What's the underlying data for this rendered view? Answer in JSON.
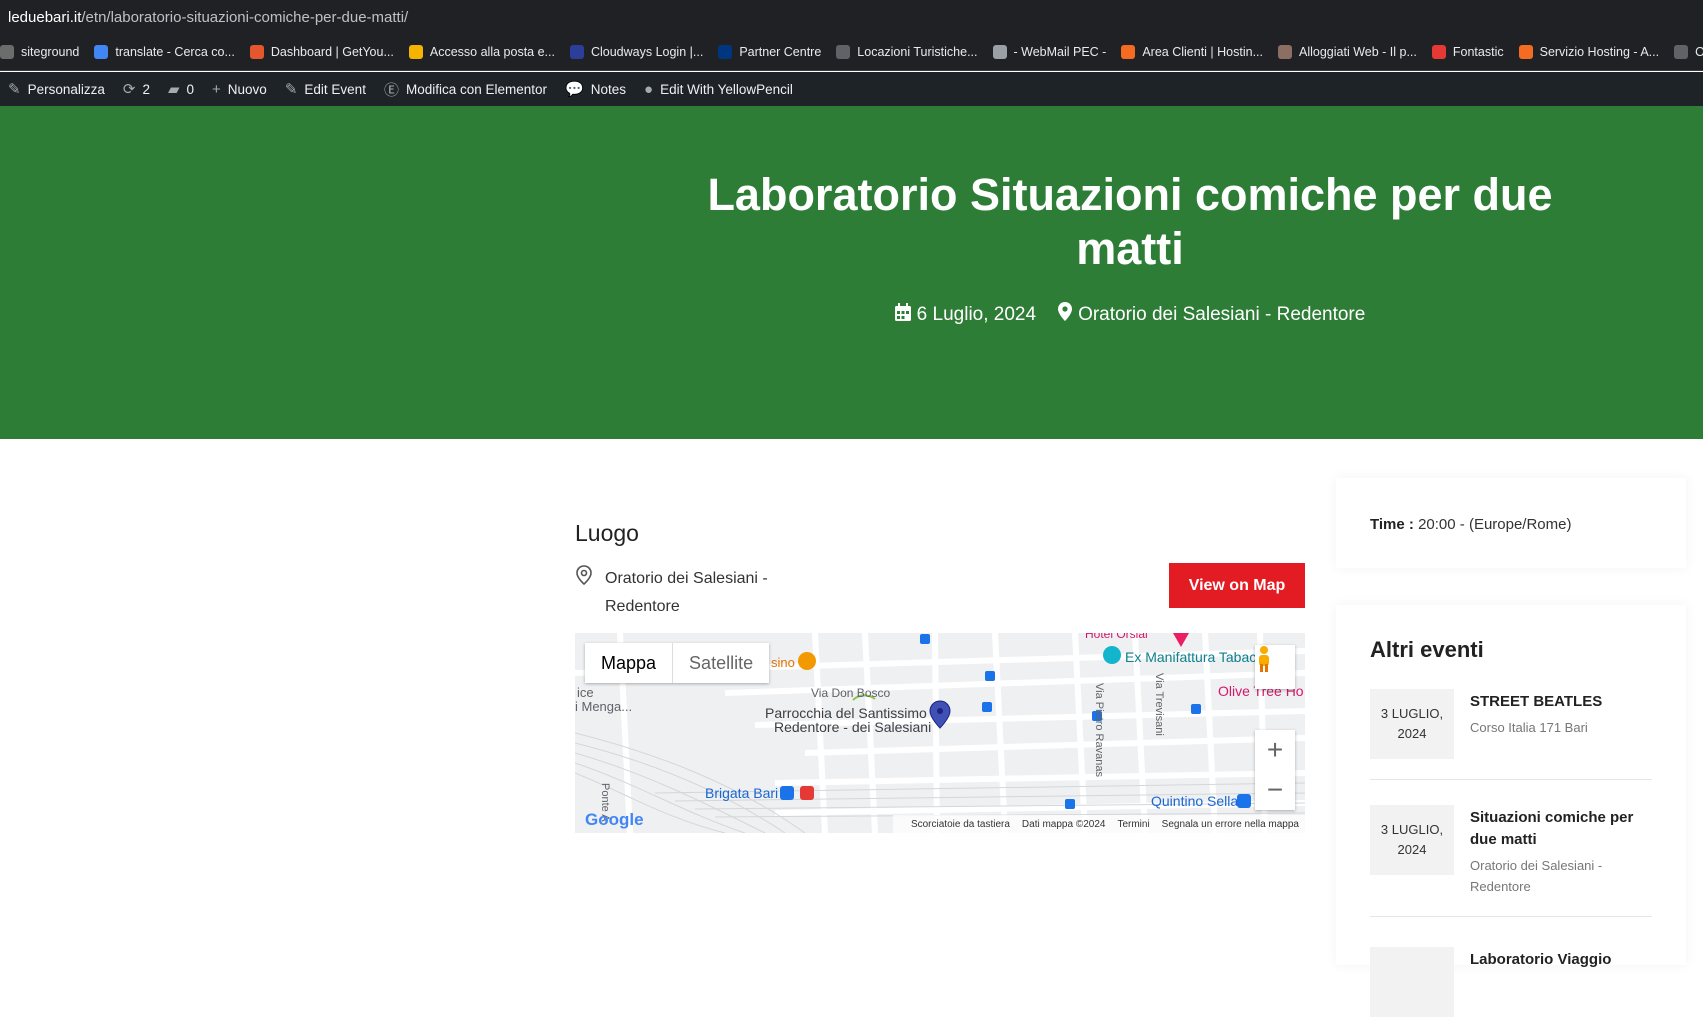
{
  "browser": {
    "url_host": "leduebari.it",
    "url_path": "/etn/laboratorio-situazioni-comiche-per-due-matti/",
    "bookmarks": [
      {
        "label": "siteground",
        "color": "#6c6c6c"
      },
      {
        "label": "translate - Cerca co...",
        "color": "#4285f4"
      },
      {
        "label": "Dashboard | GetYou...",
        "color": "#e4572e"
      },
      {
        "label": "Accesso alla posta e...",
        "color": "#f4b400"
      },
      {
        "label": "Cloudways Login |...",
        "color": "#2c3e99"
      },
      {
        "label": "Partner Centre",
        "color": "#003580"
      },
      {
        "label": "Locazioni Turistiche...",
        "color": "#5f6368"
      },
      {
        "label": "- WebMail PEC -",
        "color": "#9aa0a6"
      },
      {
        "label": "Area Clienti | Hostin...",
        "color": "#f36c21"
      },
      {
        "label": "Alloggiati Web - Il p...",
        "color": "#8d6e63"
      },
      {
        "label": "Fontastic",
        "color": "#e53935"
      },
      {
        "label": "Servizio Hosting - A...",
        "color": "#f36c21"
      },
      {
        "label": "Operatori r",
        "color": "#5f6368"
      }
    ]
  },
  "wpbar": {
    "items": [
      {
        "label": "Personalizza",
        "icon": "brush-icon"
      },
      {
        "label": "2",
        "icon": "updates-icon"
      },
      {
        "label": "0",
        "icon": "comment-icon"
      },
      {
        "label": "Nuovo",
        "icon": "plus-icon"
      },
      {
        "label": "Edit Event",
        "icon": "pencil-icon"
      },
      {
        "label": "Modifica con Elementor",
        "icon": "elementor-icon"
      },
      {
        "label": "Notes",
        "icon": "notes-icon"
      },
      {
        "label": "Edit With YellowPencil",
        "icon": "yellowpencil-icon"
      }
    ]
  },
  "hero": {
    "title": "Laboratorio Situazioni comiche per due matti",
    "date": "6 Luglio, 2024",
    "location": "Oratorio dei Salesiani - Redentore",
    "bg_color": "#2e7d37"
  },
  "venue": {
    "heading": "Luogo",
    "address_line1": "Oratorio dei Salesiani -",
    "address_line2": "Redentore",
    "view_button": "View on Map"
  },
  "map": {
    "type_map": "Mappa",
    "type_satellite": "Satellite",
    "labels": {
      "place": "Parrocchia del Santissimo",
      "place2": "Redentore - dei Salesiani",
      "street1": "Via Don Bosco",
      "street2": "Via Pietro Ravanas",
      "street3": "Via Trevisani",
      "poi1": "Ex Manifattura Tabac",
      "poi2": "Hotel Orsial",
      "poi3": "Olive Tree Ho",
      "poi4": "Brigata Bari",
      "poi5": "Quintino Sella",
      "poi6": "ice",
      "poi7": "i Menga...",
      "poi8": "sino",
      "poi9": "Ponte A"
    },
    "logo": "Google",
    "attribution": [
      "Scorciatoie da tastiera",
      "Dati mappa ©2024",
      "Termini",
      "Segnala un errore nella mappa"
    ]
  },
  "sidebar": {
    "time_label": "Time :",
    "time_value": "20:00 - (Europe/Rome)",
    "other_heading": "Altri eventi",
    "events": [
      {
        "date1": "3 LUGLIO,",
        "date2": "2024",
        "title": "STREET BEATLES",
        "loc1": "Corso Italia 171 Bari",
        "loc2": ""
      },
      {
        "date1": "3 LUGLIO,",
        "date2": "2024",
        "title": "Situazioni comiche per due matti",
        "loc1": "Oratorio dei Salesiani -",
        "loc2": "Redentore"
      },
      {
        "date1": "",
        "date2": "",
        "title": "Laboratorio Viaggio",
        "loc1": "",
        "loc2": ""
      }
    ]
  }
}
